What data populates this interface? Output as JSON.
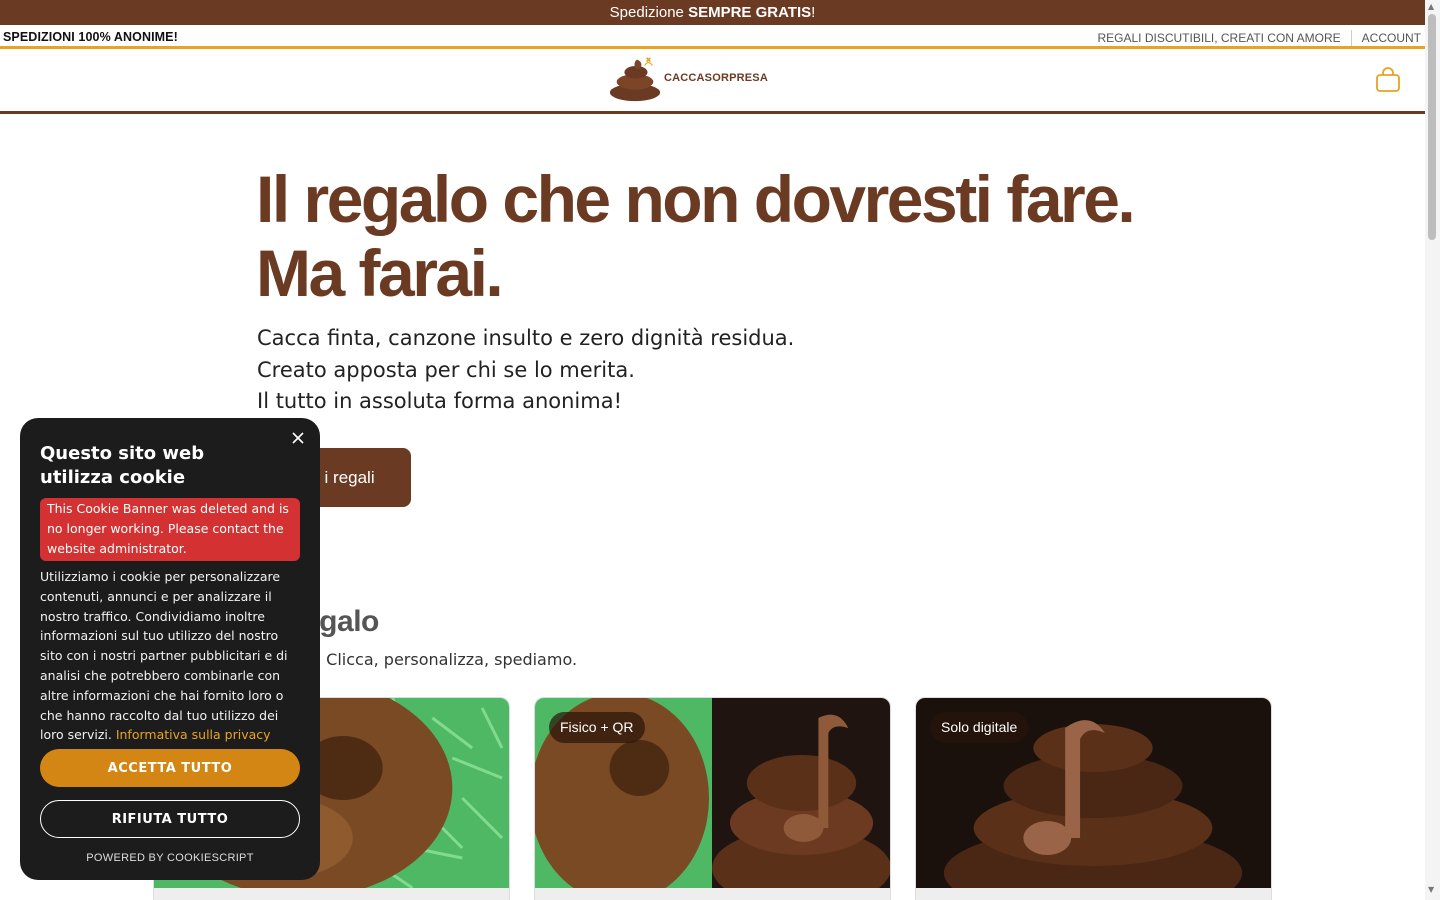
{
  "promo": {
    "prefix": "Spedizione ",
    "bold": "SEMPRE GRATIS",
    "suffix": "!"
  },
  "utility": {
    "left": "SPEDIZIONI 100% ANONIME!",
    "tagline": "REGALI DISCUTIBILI, CREATI CON AMORE",
    "account": "ACCOUNT"
  },
  "header": {
    "logo_text": "CACCASORPRESA",
    "cart_icon": "shopping-bag-icon"
  },
  "hero": {
    "title_line1": "Il regalo che non dovresti fare.",
    "title_line2": "Ma farai.",
    "sub_line1": "Cacca finta, canzone insulto e zero dignità residua.",
    "sub_line2": "Creato apposta per chi se lo merita.",
    "sub_line3": "Il tutto in assoluta forma anonima!",
    "cta_visible": "ri i regali"
  },
  "section": {
    "title_visible": "egalo",
    "subtitle_visible": ". Clicca, personalizza, spediamo."
  },
  "cards": [
    {
      "badge": ""
    },
    {
      "badge": "Fisico + QR"
    },
    {
      "badge": "Solo digitale"
    }
  ],
  "cookie": {
    "title": "Questo sito web utilizza cookie",
    "alert": "This Cookie Banner was deleted and is no longer working. Please contact the website administrator.",
    "body": "Utilizziamo i cookie per personalizzare contenuti, annunci e per analizzare il nostro traffico. Condividiamo inoltre informazioni sul tuo utilizzo del nostro sito con i nostri partner pubblicitari e di analisi che potrebbero combinarle con altre informazioni che hai fornito loro o che hanno raccolto dal tuo utilizzo dei loro servizi. ",
    "privacy_link": "Informativa sulla privacy",
    "accept": "ACCETTA TUTTO",
    "reject": "RIFIUTA TUTTO",
    "powered": "POWERED BY COOKIESCRIPT"
  },
  "colors": {
    "brown": "#6b3a22",
    "accent": "#e8a323",
    "accept": "#d48614",
    "alert": "#d43232"
  }
}
